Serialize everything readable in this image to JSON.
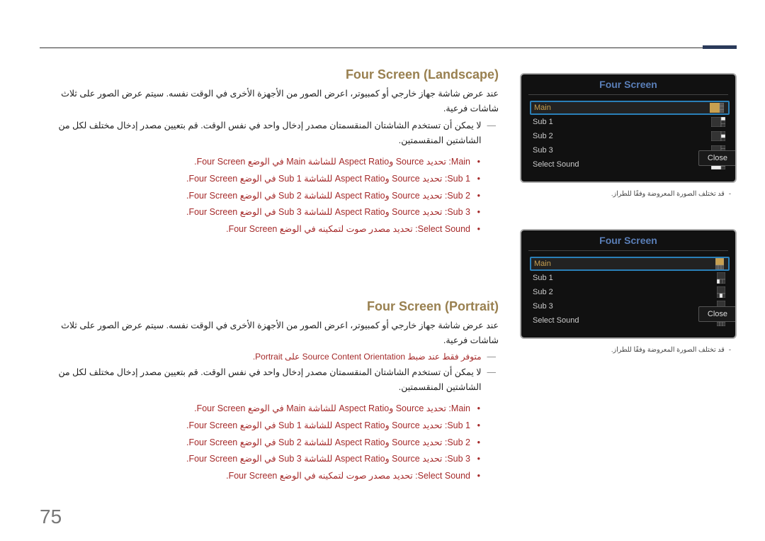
{
  "page_number": "75",
  "sections": {
    "landscape": {
      "title": "Four Screen (Landscape)",
      "body": "عند عرض شاشة جهاز خارجي أو كمبيوتر، اعرض الصور من الأجهزة الأخرى في الوقت نفسه. سيتم عرض الصور على ثلاث شاشات فرعية.",
      "note": "لا يمكن أن تستخدم الشاشتان المنقسمتان مصدر إدخال واحد في نفس الوقت. قم بتعيين مصدر إدخال مختلف لكل من الشاشتين المنقسمتين.",
      "bullets": {
        "b1": "Main: تحديد Source وAspect Ratio للشاشة Main في الوضع Four Screen.",
        "b2": "Sub 1: تحديد Source وAspect Ratio للشاشة Sub 1 في الوضع Four Screen.",
        "b3": "Sub 2: تحديد Source وAspect Ratio للشاشة Sub 2 في الوضع Four Screen.",
        "b4": "Sub 3: تحديد Source وAspect Ratio للشاشة Sub 3 في الوضع Four Screen.",
        "b5": "Select Sound: تحديد مصدر صوت لتمكينه في الوضع Four Screen."
      }
    },
    "portrait": {
      "title": "Four Screen (Portrait)",
      "body": "عند عرض شاشة جهاز خارجي أو كمبيوتر، اعرض الصور من الأجهزة الأخرى في الوقت نفسه. سيتم عرض الصور على ثلاث شاشات فرعية.",
      "portrait_note": "متوفر فقط عند ضبط Source Content Orientation على Portrait.",
      "note": "لا يمكن أن تستخدم الشاشتان المنقسمتان مصدر إدخال واحد في نفس الوقت. قم بتعيين مصدر إدخال مختلف لكل من الشاشتين المنقسمتين.",
      "bullets": {
        "b1": "Main: تحديد Source وAspect Ratio للشاشة Main في الوضع Four Screen.",
        "b2": "Sub 1: تحديد Source وAspect Ratio للشاشة Sub 1 في الوضع Four Screen.",
        "b3": "Sub 2: تحديد Source وAspect Ratio للشاشة Sub 2 في الوضع Four Screen.",
        "b4": "Sub 3: تحديد Source وAspect Ratio للشاشة Sub 3 في الوضع Four Screen.",
        "b5": "Select Sound: تحديد مصدر صوت لتمكينه في الوضع Four Screen."
      }
    }
  },
  "panels": {
    "title": "Four Screen",
    "items": {
      "main": "Main",
      "sub1": "Sub 1",
      "sub2": "Sub 2",
      "sub3": "Sub 3",
      "sound": "Select Sound"
    },
    "close": "Close"
  },
  "disclaimer": "قد تختلف الصورة المعروضة وفقًا للطراز."
}
